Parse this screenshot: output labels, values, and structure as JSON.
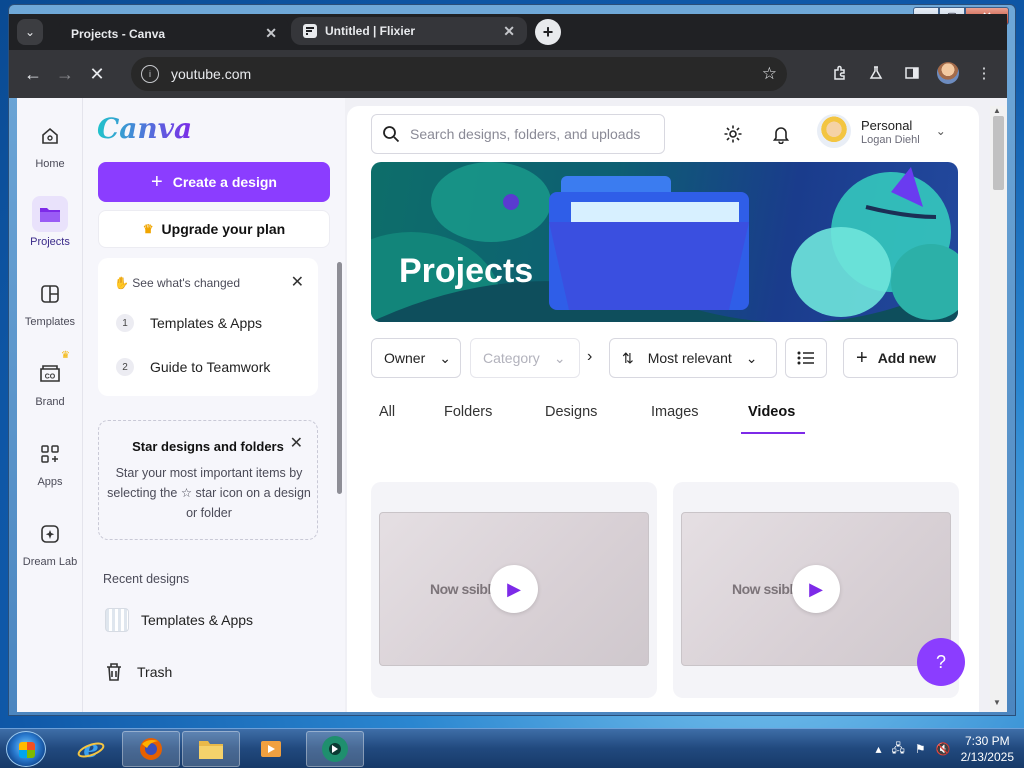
{
  "browser": {
    "tabs": [
      {
        "title": "Projects - Canva",
        "active": true
      },
      {
        "title": "Untitled | Flixier",
        "active": false
      }
    ],
    "url": "youtube.com"
  },
  "rail": {
    "items": [
      {
        "label": "Home",
        "icon": "home-icon"
      },
      {
        "label": "Projects",
        "icon": "folder-icon",
        "active": true
      },
      {
        "label": "Templates",
        "icon": "templates-icon"
      },
      {
        "label": "Brand",
        "icon": "brand-icon"
      },
      {
        "label": "Apps",
        "icon": "apps-icon"
      },
      {
        "label": "Dream Lab",
        "icon": "dream-lab-icon"
      }
    ]
  },
  "panel": {
    "logo": "Canva",
    "create_label": "Create a design",
    "upgrade_label": "Upgrade your plan",
    "changed": {
      "heading": "See what's changed",
      "items": [
        {
          "num": "1",
          "label": "Templates & Apps"
        },
        {
          "num": "2",
          "label": "Guide to Teamwork"
        }
      ]
    },
    "star_card": {
      "title": "Star designs and folders",
      "body": "Star your most important items by selecting the ☆ star icon on a design or folder"
    },
    "recent_heading": "Recent designs",
    "recent_item": "Templates & Apps",
    "trash_label": "Trash"
  },
  "main": {
    "search_placeholder": "Search designs, folders, and uploads",
    "profile": {
      "name": "Personal",
      "sub": "Logan Diehl"
    },
    "banner_title": "Projects",
    "filters": {
      "owner": "Owner",
      "category": "Category",
      "sort": "Most relevant",
      "add_new": "Add new"
    },
    "tabs": [
      "All",
      "Folders",
      "Designs",
      "Images",
      "Videos"
    ],
    "active_tab": "Videos",
    "videos": [
      {
        "text": "Now     ssible"
      },
      {
        "text": "Now     ssible"
      }
    ],
    "help_label": "?"
  },
  "taskbar": {
    "time": "7:30 PM",
    "date": "2/13/2025"
  },
  "colors": {
    "brand_purple": "#8b3dff",
    "accent_teal": "#20c4cb"
  }
}
